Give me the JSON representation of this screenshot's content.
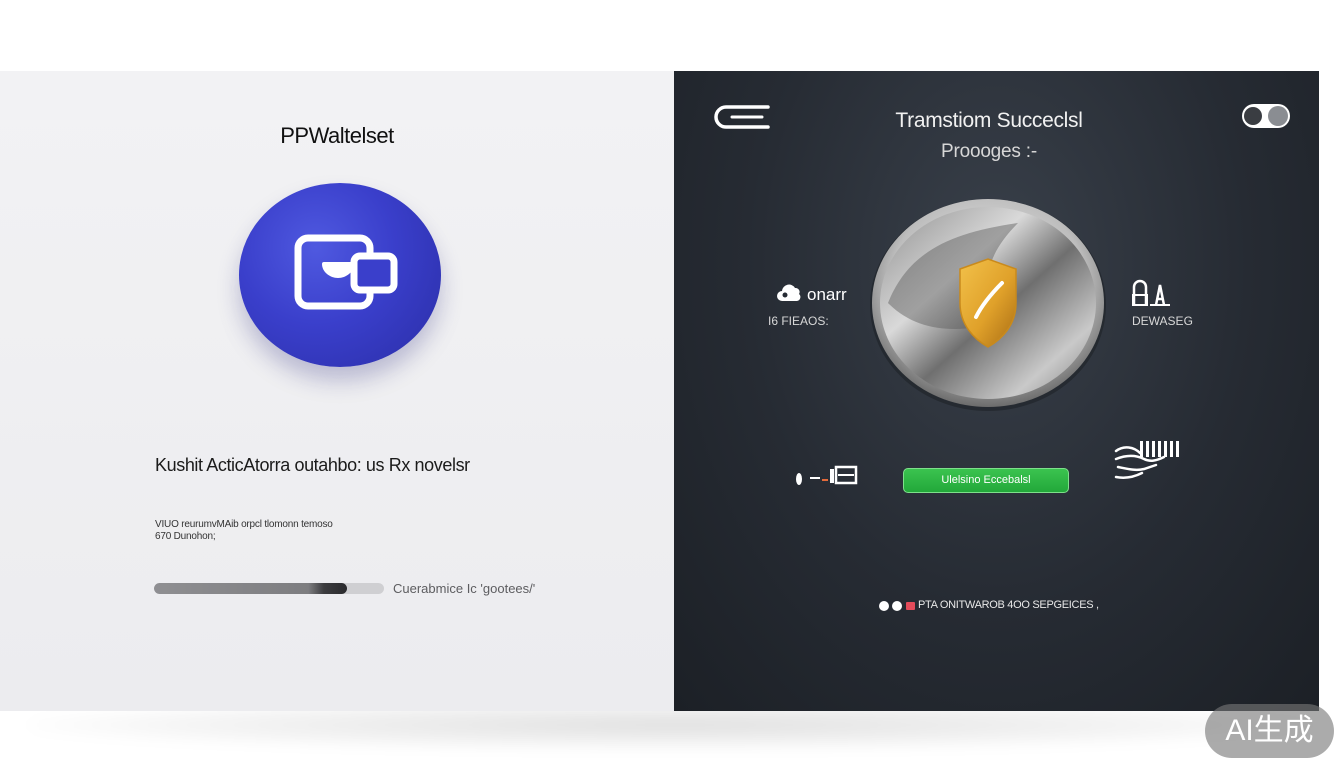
{
  "left_panel": {
    "app_title": "PPWaltelset",
    "app_logo_icon": "wallet-icon",
    "headline": "Kushit ActicAtorra outahbo: us Rx novelsr",
    "detail_line_1": "VIUO reurumvMAib orpcl tlomonn temoso",
    "detail_line_2": "670 Dunohon;",
    "progress": {
      "fraction": 0.84,
      "label": "Cuerabmice Ic 'gootees/'"
    }
  },
  "right_panel": {
    "back_icon": "back-arrow-icon",
    "title": "Tramstiom Succeclsl",
    "subtitle": "Proooges :-",
    "toggle_icon": "toggle-switch-icon",
    "center_icon": "shield-check-icon",
    "left_stat": {
      "icon": "cloud-icon",
      "label": "onarr",
      "caption": "I6 FIEAOS:"
    },
    "right_stat": {
      "icon": "lock-arrow-icon",
      "caption": "DEWASEG"
    },
    "signal_icon": "signal-bars-icon",
    "action_button_label": "Ulelsino Eccebalsl",
    "hand_icon": "payment-hand-icon",
    "footer_text": "PTA ONITWAROB 4OO SEPGEICES ,"
  },
  "watermark": "AI生成",
  "colors": {
    "left_bg": "#eeeef0",
    "right_bg": "#262b33",
    "logo_blue": "#3a3fcb",
    "button_green": "#22a83a",
    "shield_gold": "#e0a12a"
  }
}
